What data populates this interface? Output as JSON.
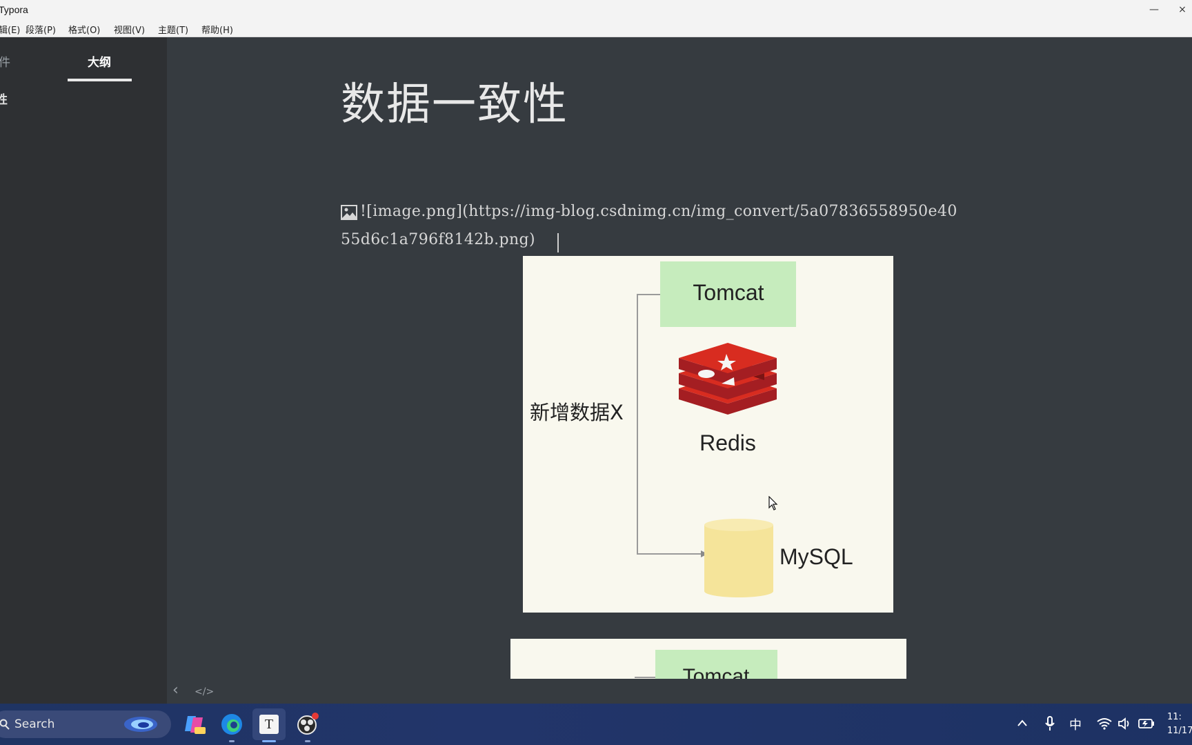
{
  "window": {
    "title": "Typora",
    "minimize_glyph": "—",
    "close_glyph": "×"
  },
  "menu": [
    {
      "label": "辑(E)"
    },
    {
      "label": "段落(P)"
    },
    {
      "label": "格式(O)"
    },
    {
      "label": "视图(V)"
    },
    {
      "label": "主题(T)"
    },
    {
      "label": "帮助(H)"
    }
  ],
  "sidebar": {
    "tabs": [
      {
        "label": "件"
      },
      {
        "label": "大纲"
      }
    ],
    "outline": [
      {
        "label": "性"
      }
    ]
  },
  "document": {
    "heading": "数据一致性",
    "markdown_line1": "![image.png](https://img-blog.csdnimg.cn/img_convert/5a07836558950e40",
    "markdown_line2": "55d6c1a796f8142b.png)"
  },
  "diagram": {
    "tomcat": "Tomcat",
    "redis": "Redis",
    "mysql": "MySQL",
    "action": "新增数据X",
    "colors": {
      "tomcat_box": "#c6ecbd",
      "redis": "#c8242b",
      "mysql": "#f5e49a",
      "background": "#f9f8ee"
    }
  },
  "diagram2": {
    "tomcat": "Tomcat"
  },
  "statusbar": {
    "back_icon": "chevron-left-icon",
    "source_icon": "code-icon",
    "back_glyph": "‹",
    "source_glyph": "</>"
  },
  "taskbar": {
    "search_label": "Search",
    "pinned": [
      "copilot-icon",
      "edge-icon",
      "typora-icon",
      "obs-icon"
    ],
    "typora_glyph": "T",
    "tray": {
      "ime": "中"
    },
    "clock": {
      "time": "11:",
      "date": "11/17"
    }
  }
}
